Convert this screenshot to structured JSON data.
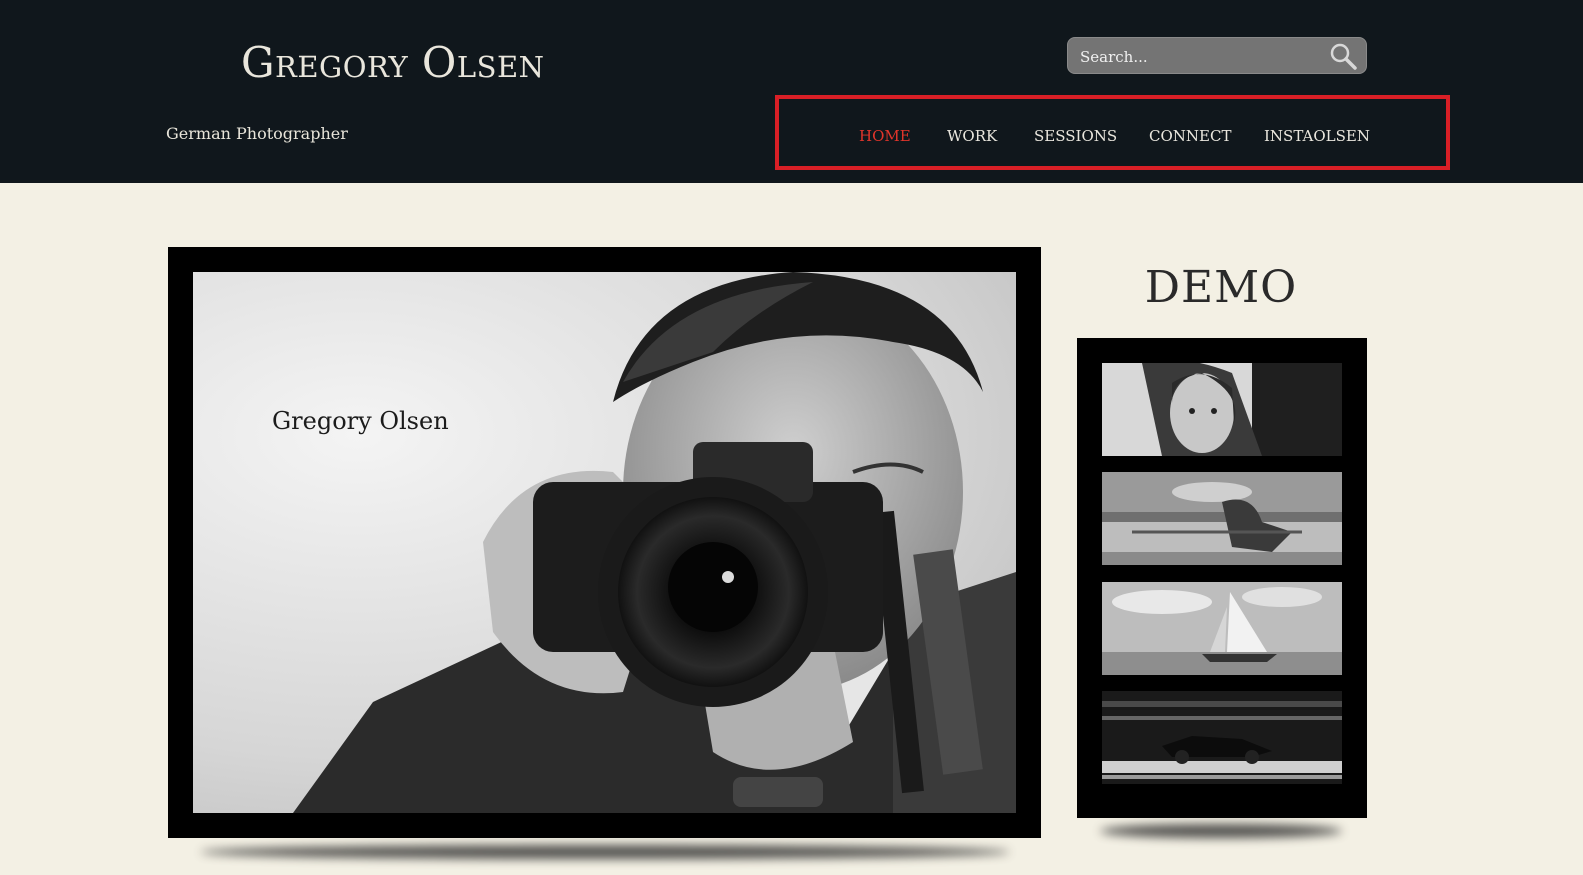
{
  "header": {
    "site_title": "Gregory Olsen",
    "tagline": "German Photographer",
    "search": {
      "placeholder": "Search...",
      "value": ""
    },
    "nav": [
      {
        "label": "HOME",
        "active": true
      },
      {
        "label": "WORK",
        "active": false
      },
      {
        "label": "SESSIONS",
        "active": false
      },
      {
        "label": "CONNECT",
        "active": false
      },
      {
        "label": "INSTAOLSEN",
        "active": false
      }
    ]
  },
  "main": {
    "hero": {
      "caption": "Gregory Olsen",
      "subject": "photographer-with-camera"
    }
  },
  "sidebar": {
    "title": "DEMO",
    "thumbnails": [
      {
        "subject": "portrait-woman"
      },
      {
        "subject": "fountain-statue"
      },
      {
        "subject": "sailboat"
      },
      {
        "subject": "race-car"
      }
    ]
  },
  "colors": {
    "header_bg": "#10171c",
    "page_bg": "#f3f0e4",
    "nav_active": "#e2352b",
    "nav_highlight_border": "#d91f26"
  }
}
